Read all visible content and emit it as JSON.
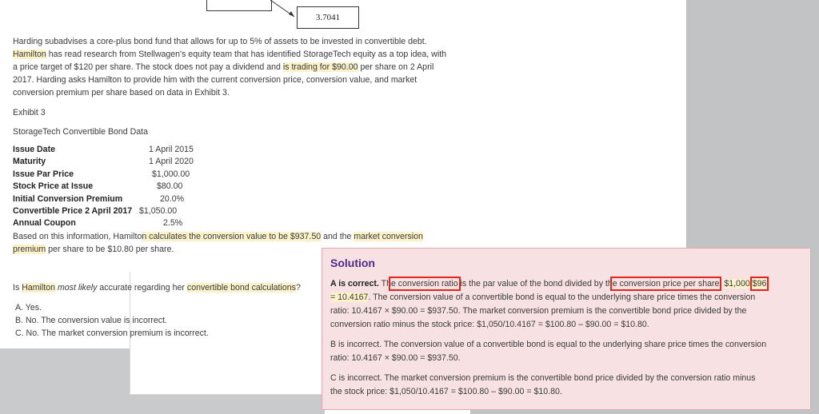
{
  "diagram": {
    "value_box": "3.7041"
  },
  "intro": {
    "p1": "Harding subadvises a core-plus bond fund that allows for up to 5% of assets to be invested in convertible debt.",
    "hamilton": "Hamilton",
    "p2": " has read research from Stellwagen's equity team that has identified StorageTech equity as a top idea, with",
    "p3a": "a price target of $120 per share. The stock does not pay a dividend and ",
    "p3b": "is trading for $90.00",
    "p3c": " per share on 2 April",
    "p4": "2017. Harding asks Hamilton to provide him with the current conversion price, conversion value, and market",
    "p5": "conversion premium per share based on data in Exhibit 3."
  },
  "exhibit": {
    "label": "Exhibit 3",
    "title": "StorageTech Convertible Bond Data",
    "rows": [
      {
        "label": "Issue Date",
        "value": "1 April 2015"
      },
      {
        "label": "Maturity",
        "value": "1 April 2020"
      },
      {
        "label": "Issue Par Price",
        "value": "$1,000.00"
      },
      {
        "label": "Stock Price at Issue",
        "value": "$80.00"
      },
      {
        "label": "Initial Conversion Premium",
        "value": "20.0%"
      },
      {
        "label": "Convertible Price 2 April 2017",
        "value": "$1,050.00"
      },
      {
        "label": "Annual Coupon",
        "value": "2.5%"
      }
    ]
  },
  "based": {
    "a": "Based on this information, Hamilto",
    "b": "n calculates the conversion value to be $937.50",
    "c": " and the ",
    "d": "market conversion",
    "e": "premium",
    "f": " per share to be $10.80 per share."
  },
  "question": {
    "a": "Is ",
    "b": "Hamilton",
    "c": " ",
    "d": "most likely",
    "e": " accurate regarding her ",
    "f": "convertible bond calculations",
    "g": "?"
  },
  "options": [
    "A. Yes.",
    "B. No. The conversion value is incorrect.",
    "C. No. The market conversion premium is incorrect."
  ],
  "solution": {
    "title": "Solution",
    "a_correct": "A is correct.",
    "a1": " Th",
    "a2": "e conversion ratio",
    "a3": " is the par value of the bond divided by th",
    "a4": "e conversion price per share",
    "a5": ": ",
    "a6": "$1,000/",
    "a7": "$96",
    "a8": "= 10.4167",
    "a9": ". The conversion value of a convertible bond is equal to the underlying share price times the conversion",
    "a10": "ratio: 10.4167 × $90.00 = $937.50. The market conversion premium is the convertible bond price divided by the",
    "a11": "conversion ratio minus the stock price: $1,050/10.4167 = $100.80 – $90.00 = $10.80.",
    "b1": "B is incorrect. The conversion value of a convertible bond is equal to the underlying share price times the conversion",
    "b2": "ratio: 10.4167 × $90.00 = $937.50.",
    "c1": "C is incorrect. The market conversion premium is the convertible bond price divided by the conversion ratio minus",
    "c2": "the stock price: $1,050/10.4167 = $100.80 – $90.00 = $10.80."
  },
  "colors": {
    "highlight": "#fbf2c9",
    "solution_bg": "#f8e1e3",
    "solution_title": "#4b2b87",
    "annotation_red": "#e0251b"
  }
}
